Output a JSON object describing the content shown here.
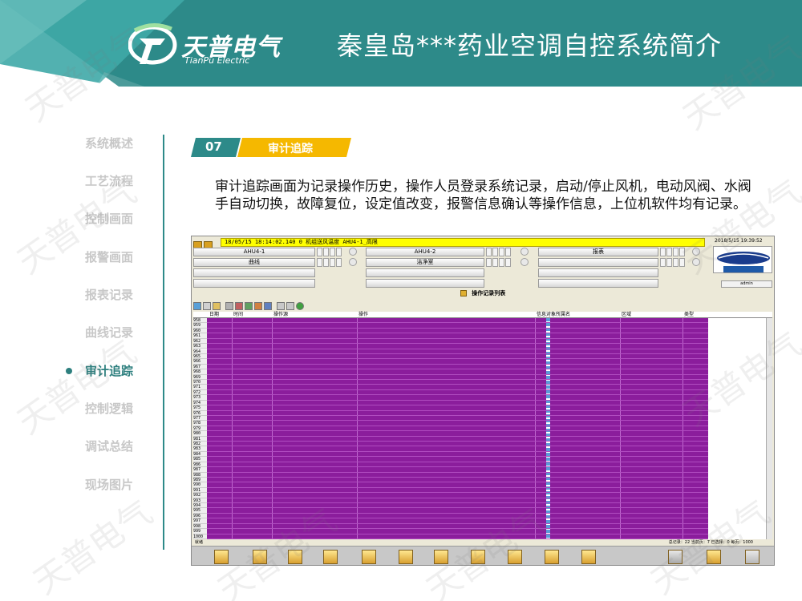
{
  "header": {
    "logo_cn": "天普电气",
    "logo_en": "TianPu Electric",
    "title": "秦皇岛***药业空调自控系统简介"
  },
  "nav": {
    "items": [
      {
        "label": "系统概述",
        "active": false
      },
      {
        "label": "工艺流程",
        "active": false
      },
      {
        "label": "控制画面",
        "active": false
      },
      {
        "label": "报警画面",
        "active": false
      },
      {
        "label": "报表记录",
        "active": false
      },
      {
        "label": "曲线记录",
        "active": false
      },
      {
        "label": "审计追踪",
        "active": true
      },
      {
        "label": "控制逻辑",
        "active": false
      },
      {
        "label": "调试总结",
        "active": false
      },
      {
        "label": "现场图片",
        "active": false
      }
    ]
  },
  "section": {
    "number": "07",
    "label": "审计追踪",
    "description": "审计追踪画面为记录操作历史，操作人员登录系统记录，启动/停止风机，电动风阀、水阀手自动切换，故障复位，设定值改变，报警信息确认等操作信息，上位机软件均有记录。"
  },
  "screenshot": {
    "alarm_text": "18/05/15 18:14:02.140 0  机组送风温度 AHU4-1_高限",
    "alarm_sub": "",
    "datetime": "2018/5/15 19:39:52",
    "buttons_row1": [
      "AHU4-1",
      "AHU4-2",
      "报表"
    ],
    "buttons_row2": [
      "曲线",
      "洁净室",
      ""
    ],
    "list_title": "操作记录列表",
    "logo_caption": "",
    "logo_sub": "admin",
    "columns": [
      "日期",
      "时间",
      "操作源",
      "操作",
      "信息对象所属名",
      "区域",
      "类型"
    ],
    "row_numbers": [
      "958",
      "959",
      "960",
      "961",
      "962",
      "963",
      "964",
      "965",
      "966",
      "967",
      "968",
      "969",
      "970",
      "971",
      "972",
      "973",
      "974",
      "975",
      "976",
      "977",
      "978",
      "979",
      "980",
      "981",
      "982",
      "983",
      "984",
      "985",
      "986",
      "987",
      "988",
      "989",
      "990",
      "991",
      "992",
      "993",
      "994",
      "995",
      "996",
      "997",
      "998",
      "999",
      "1000"
    ],
    "status_left": "就绪",
    "status_right": "总记录：22  当前页：7  已选择：0  每页：1000"
  },
  "colors": {
    "teal": "#2d8a89",
    "teal_light": "#3aa7a6",
    "accent_yellow": "#f5b800",
    "purple_rows": "#8b1d9c",
    "alarm_yellow": "#ffff00"
  },
  "watermark": "天普电气"
}
